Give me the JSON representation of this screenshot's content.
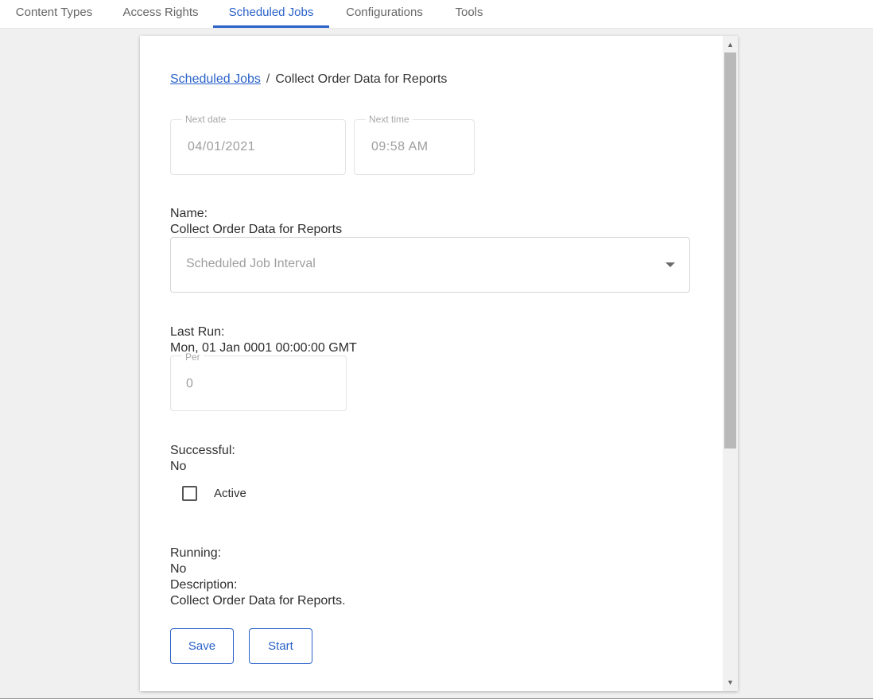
{
  "nav": {
    "tabs": [
      {
        "label": "Content Types"
      },
      {
        "label": "Access Rights"
      },
      {
        "label": "Scheduled Jobs"
      },
      {
        "label": "Configurations"
      },
      {
        "label": "Tools"
      }
    ],
    "active_tab": "Scheduled Jobs"
  },
  "breadcrumb": {
    "parent": "Scheduled Jobs",
    "separator": "/",
    "current": "Collect Order Data for Reports"
  },
  "next_date": {
    "legend": "Next date",
    "value": "04/01/2021"
  },
  "next_time": {
    "legend": "Next time",
    "value": "09:58 AM"
  },
  "name": {
    "label": "Name:",
    "value": "Collect Order Data for Reports"
  },
  "interval_select": {
    "placeholder": "Scheduled Job Interval"
  },
  "last_run": {
    "label": "Last Run:",
    "value": "Mon, 01 Jan 0001 00:00:00 GMT"
  },
  "per": {
    "legend": "Per",
    "value": "0"
  },
  "successful": {
    "label": "Successful:",
    "value": "No"
  },
  "active": {
    "label": "Active",
    "checked": false
  },
  "running": {
    "label": "Running:",
    "value": "No"
  },
  "description": {
    "label": "Description:",
    "value": "Collect Order Data for Reports."
  },
  "buttons": {
    "save": "Save",
    "start": "Start"
  },
  "colors": {
    "accent": "#2a62c9",
    "background": "#f0f0f0",
    "panel": "#ffffff"
  }
}
